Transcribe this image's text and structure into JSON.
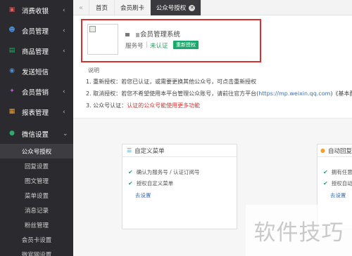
{
  "sidebar": {
    "menu": [
      {
        "label": "消费收银",
        "icon": "cashier-icon",
        "color": "#e05a5a"
      },
      {
        "label": "会员管理",
        "icon": "members-icon",
        "color": "#4a8fd6"
      },
      {
        "label": "商品管理",
        "icon": "goods-icon",
        "color": "#2eaa69"
      },
      {
        "label": "发送短信",
        "icon": "sms-icon",
        "color": "#4a8fd6"
      },
      {
        "label": "会员营销",
        "icon": "gift-icon",
        "color": "#b45fd6"
      },
      {
        "label": "报表管理",
        "icon": "report-icon",
        "color": "#f0a030"
      },
      {
        "label": "微信设置",
        "icon": "wechat-icon",
        "color": "#2eaa69"
      }
    ],
    "submenu": [
      "公众号授权",
      "回复设置",
      "图文管理",
      "菜单设置",
      "消息记录",
      "粉丝管理",
      "会员卡设置",
      "微官网设置"
    ],
    "active_submenu": "公众号授权"
  },
  "tabs": {
    "collapse_glyph": "«",
    "items": [
      {
        "label": "首页"
      },
      {
        "label": "会员刷卡"
      },
      {
        "label": "公众号授权",
        "closable": true,
        "close_glyph": "✕"
      }
    ]
  },
  "account": {
    "name": "会员管理系统",
    "type": "服务号",
    "separator": "|",
    "status": "未认证",
    "reauth_button": "重新授权"
  },
  "notes": {
    "title": "说明",
    "line1": "1. 重新授权：若您已认证，或需要更换其他公众号，可点击重新授权",
    "line2_prefix": "2. 取消授权：若您不希望使用本平台管理公众账号，请前往官方平台(",
    "line2_link": "https://mp.weixin.qq.com",
    "line2_suffix": ")《基本配置-己",
    "line3_prefix": "3. 公众号认证：",
    "line3_warn": "认证的公众号能使用更多功能"
  },
  "cards": {
    "menu_card": {
      "title": "自定义菜单",
      "line1": "确认为服务号 / 认证订阅号",
      "line2": "授权自定义菜单",
      "link": "去设置"
    },
    "reply_card": {
      "title": "自动回复",
      "line1": "拥有任意",
      "line2": "授权自动",
      "link": "去设置"
    }
  },
  "watermark": "软件技巧",
  "colors": {
    "sidebar_bg": "#2b2b2f",
    "active_tab": "#39393e",
    "highlight_frame": "#d9302f",
    "success": "#1aa86b",
    "link": "#3a6db0"
  }
}
